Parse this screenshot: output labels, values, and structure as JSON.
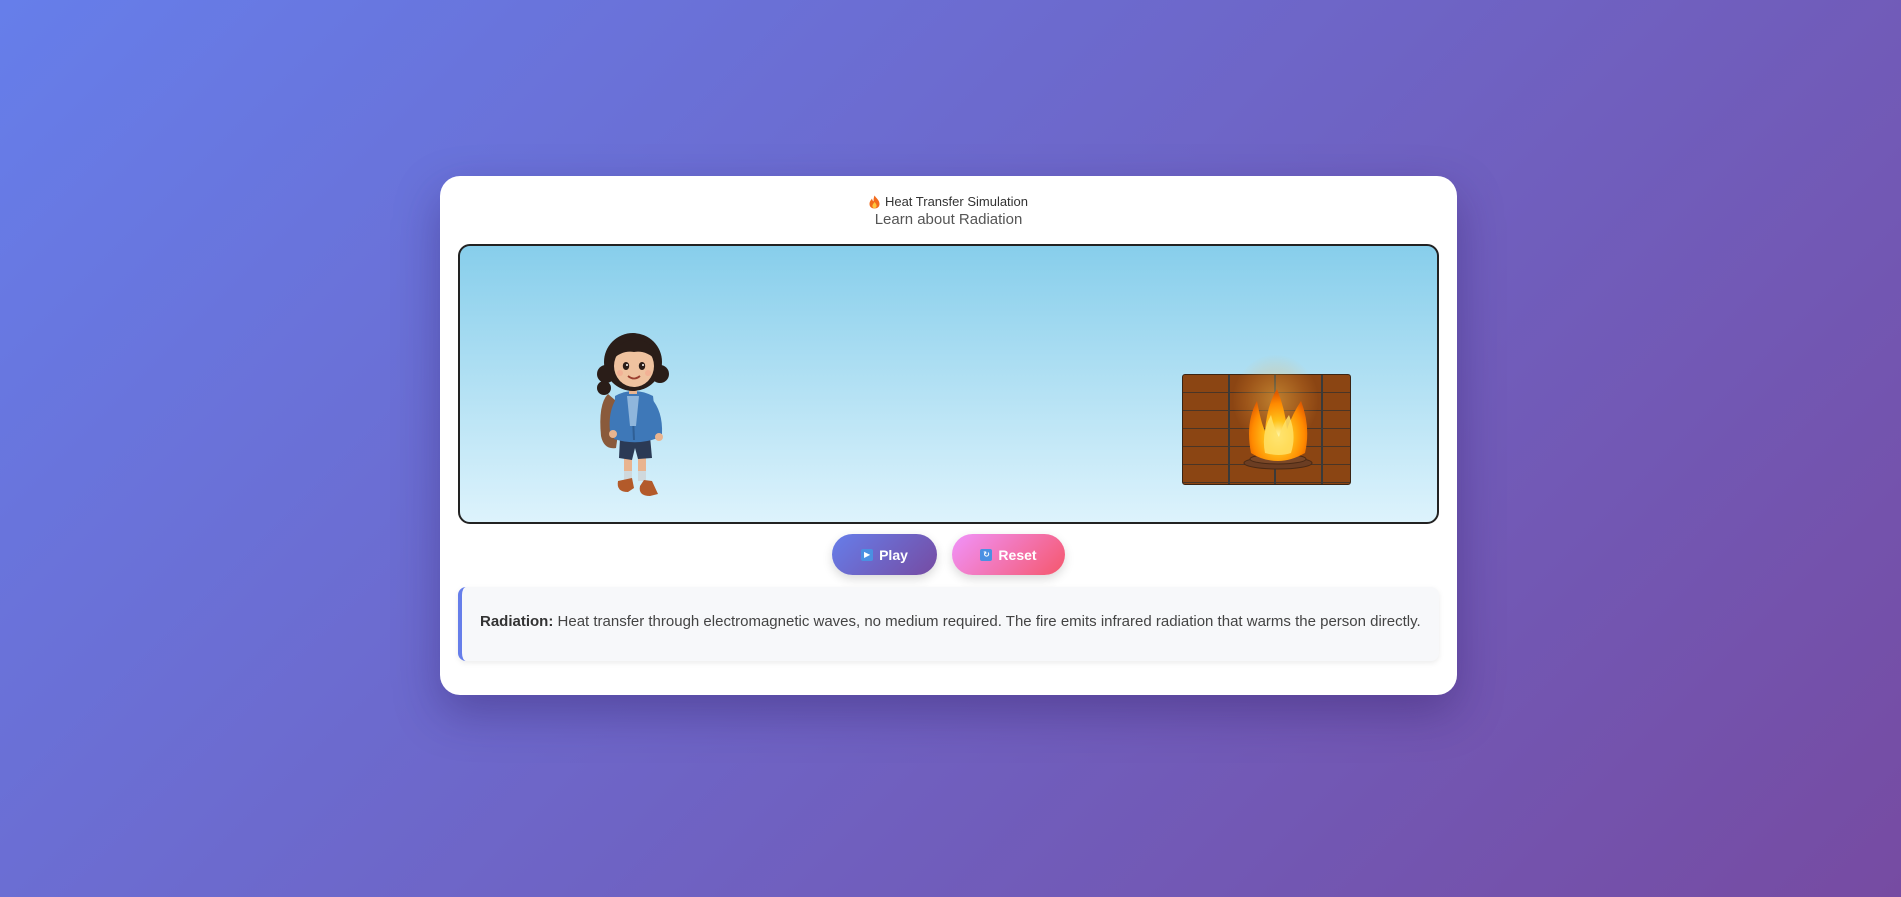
{
  "header": {
    "title": "Heat Transfer Simulation",
    "subtitle": "Learn about Radiation"
  },
  "controls": {
    "play_label": "Play",
    "reset_label": "Reset"
  },
  "info": {
    "term": "Radiation:",
    "description": "Heat transfer through electromagnetic waves, no medium required. The fire emits infrared radiation that warms the person directly."
  },
  "icons": {
    "title": "fire-icon",
    "play": "play-icon",
    "reset": "reset-icon"
  },
  "colors": {
    "background_start": "#667eea",
    "background_end": "#764ba2",
    "sky_top": "#87ceeb",
    "sky_bottom": "#ddf3fc",
    "brick": "#8b4513",
    "play_button_start": "#667eea",
    "play_button_end": "#764ba2",
    "reset_button_start": "#f093fb",
    "reset_button_end": "#f5576c"
  }
}
